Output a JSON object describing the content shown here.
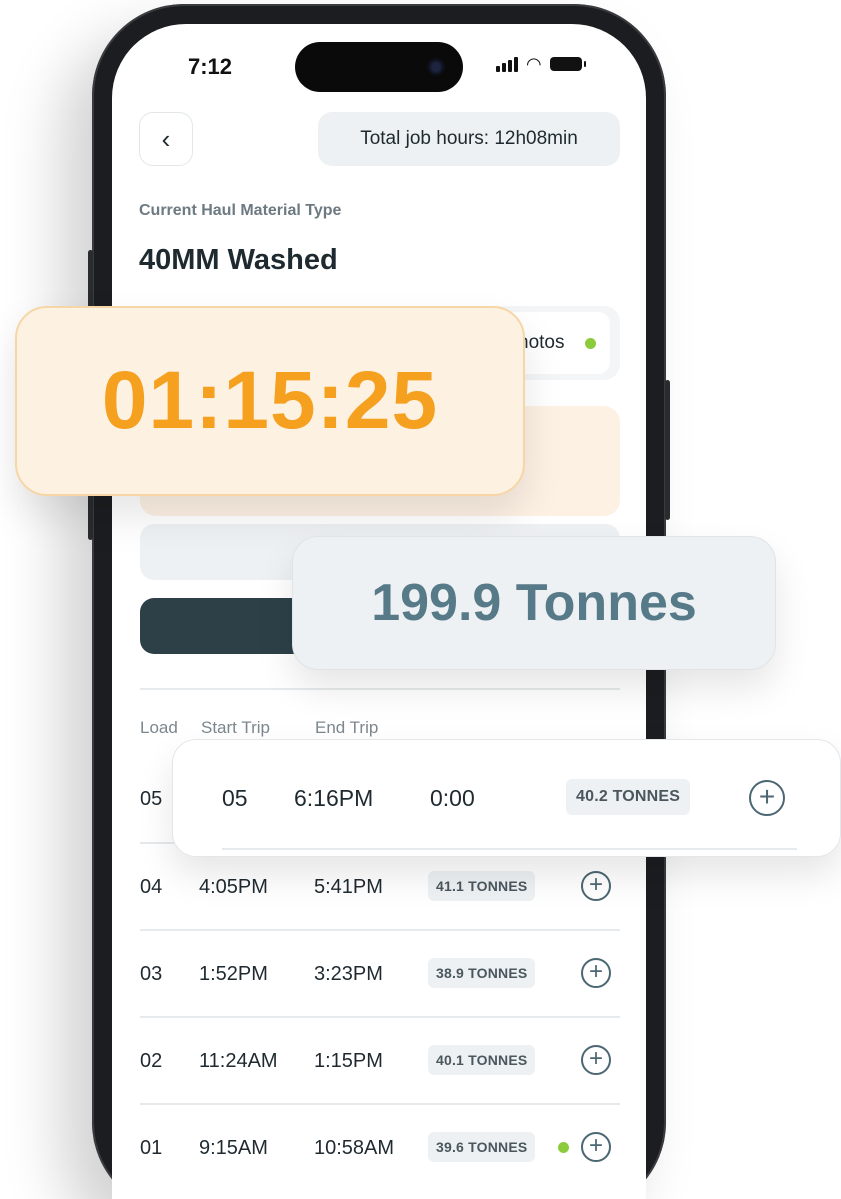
{
  "status_bar": {
    "time": "7:12"
  },
  "header": {
    "back_icon": "chevron-left-icon",
    "total_job_hours": "Total job hours: 12h08min"
  },
  "material": {
    "label": "Current Haul Material Type",
    "value": "40MM Washed"
  },
  "photos": {
    "label": "hotos",
    "status_color": "#8ccc3c"
  },
  "timer": {
    "value": "01:15:25",
    "color": "#f5a01f"
  },
  "tonnes_total": {
    "value": "199.9 Tonnes",
    "color": "#577a89"
  },
  "table": {
    "headers": [
      "Load",
      "Start Trip",
      "End Trip"
    ],
    "rows": [
      {
        "load": "05",
        "start": "",
        "end": "",
        "tonnes": "",
        "dot": false
      },
      {
        "load": "04",
        "start": "4:05PM",
        "end": "5:41PM",
        "tonnes": "41.1 TONNES",
        "dot": false
      },
      {
        "load": "03",
        "start": "1:52PM",
        "end": "3:23PM",
        "tonnes": "38.9 TONNES",
        "dot": false
      },
      {
        "load": "02",
        "start": "11:24AM",
        "end": "1:15PM",
        "tonnes": "40.1 TONNES",
        "dot": false
      },
      {
        "load": "01",
        "start": "9:15AM",
        "end": "10:58AM",
        "tonnes": "39.6 TONNES",
        "dot": true
      }
    ]
  },
  "active_load": {
    "load": "05",
    "start": "6:16PM",
    "end": "0:00",
    "tonnes": "40.2 TONNES"
  },
  "icons": {
    "add": "plus-circle-icon",
    "back": "chevron-left-icon"
  }
}
